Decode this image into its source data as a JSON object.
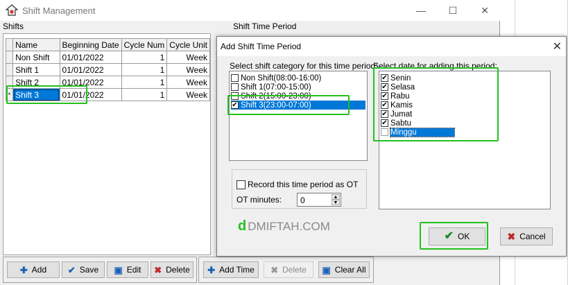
{
  "window": {
    "title": "Shift Management",
    "minimize_icon": "minimize-icon",
    "maximize_icon": "maximize-icon",
    "close_icon": "close-icon"
  },
  "sections": {
    "shifts": "Shifts",
    "shift_time_period": "Shift Time Period"
  },
  "shifts_table": {
    "columns": [
      "Name",
      "Beginning Date",
      "Cycle Num",
      "Cycle Unit"
    ],
    "rows": [
      {
        "name": "Non Shift",
        "date": "01/01/2022",
        "num": "1",
        "unit": "Week"
      },
      {
        "name": "Shift 1",
        "date": "01/01/2022",
        "num": "1",
        "unit": "Week"
      },
      {
        "name": "Shift 2",
        "date": "01/01/2022",
        "num": "1",
        "unit": "Week"
      },
      {
        "name": "Shift 3",
        "date": "01/01/2022",
        "num": "1",
        "unit": "Week"
      }
    ],
    "selected_row_marker": "*"
  },
  "toolbar_left": {
    "add": "Add",
    "save": "Save",
    "edit": "Edit",
    "delete": "Delete"
  },
  "toolbar_right": {
    "add_time": "Add Time",
    "delete": "Delete",
    "clear_all": "Clear All"
  },
  "dialog": {
    "title": "Add Shift Time Period",
    "category_label": "Select shift category for this time period:",
    "categories": [
      {
        "label": "Non Shift(08:00-16:00)",
        "checked": false
      },
      {
        "label": "Shift 1(07:00-15:00)",
        "checked": false
      },
      {
        "label": "Shift 2(15:00-23:00)",
        "checked": false
      },
      {
        "label": "Shift 3(23:00-07:00)",
        "checked": true
      }
    ],
    "date_label": "Select date for adding this period:",
    "days": [
      {
        "label": "Senin",
        "checked": true
      },
      {
        "label": "Selasa",
        "checked": true
      },
      {
        "label": "Rabu",
        "checked": true
      },
      {
        "label": "Kamis",
        "checked": true
      },
      {
        "label": "Jumat",
        "checked": true
      },
      {
        "label": "Sabtu",
        "checked": true
      },
      {
        "label": "Minggu",
        "checked": false
      }
    ],
    "record_ot_label": "Record this time period as OT",
    "ot_minutes_label": "OT minutes:",
    "ot_minutes_value": "0",
    "ok": "OK",
    "cancel": "Cancel"
  },
  "watermark": {
    "letter": "d",
    "text": "DMIFTAH.COM"
  },
  "colors": {
    "highlight": "#22c11e",
    "selection": "#0078d7"
  }
}
